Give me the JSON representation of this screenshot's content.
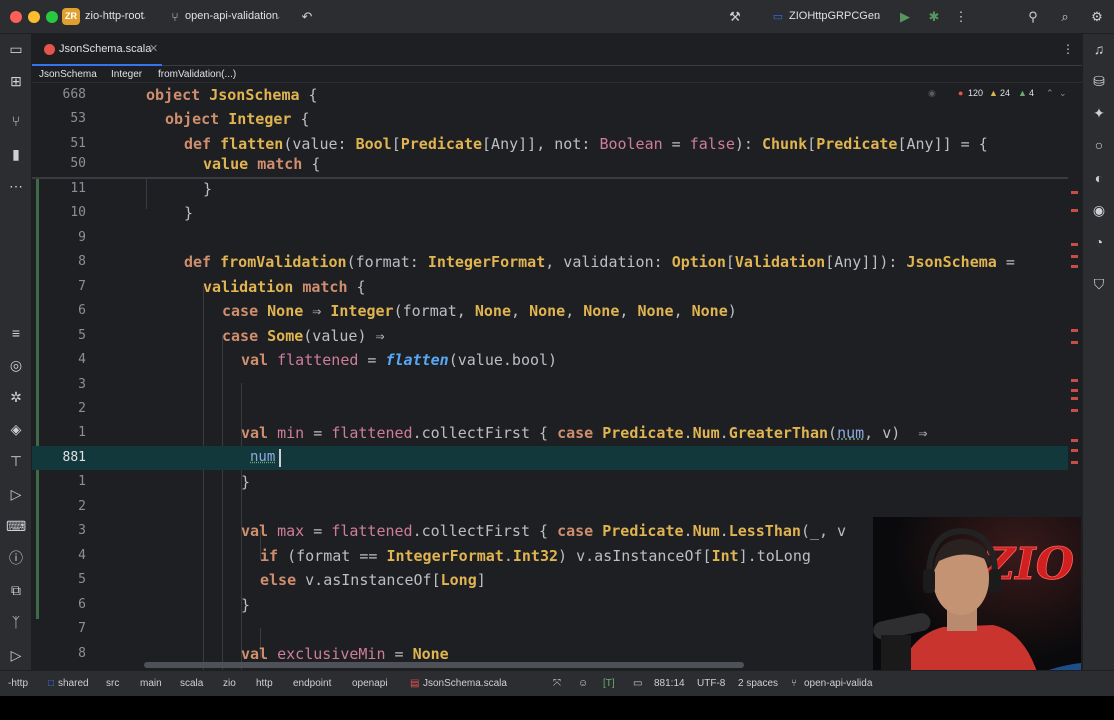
{
  "titlebar": {
    "project_badge": "ZR",
    "project_name": "zio-http-root",
    "branch": "open-api-validation",
    "run_config": "ZIOHttpGRPCGen"
  },
  "tab": {
    "label": "JsonSchema.scala"
  },
  "breadcrumb": [
    "JsonSchema",
    "Integer",
    "fromValidation(...)"
  ],
  "inspections": {
    "errors": "120",
    "warnings": "24",
    "infos": "4"
  },
  "lines": {
    "l668": "668",
    "l53": "53",
    "l51": "51",
    "l50": "50",
    "l11": "11",
    "l10": "10",
    "l9": "9",
    "l8": "8",
    "l7": "7",
    "l6": "6",
    "l5": "5",
    "l4": "4",
    "l3": "3",
    "l2": "2",
    "l1": "1",
    "l881": "881",
    "la1": "1",
    "la2": "2",
    "la3": "3",
    "la4": "4",
    "la5": "5",
    "la6": "6",
    "la7": "7",
    "la8": "8"
  },
  "code": {
    "c668": [
      "object",
      " ",
      "JsonSchema",
      " {"
    ],
    "c53": [
      "object",
      " ",
      "Integer",
      " {"
    ],
    "c51": [
      "def",
      " ",
      "flatten",
      "(value: ",
      "Bool",
      "[",
      "Predicate",
      "[Any]], not: ",
      "Boolean",
      " = ",
      "false",
      "): ",
      "Chunk",
      "[",
      "Predicate",
      "[Any]] = {"
    ],
    "c50": [
      "value",
      " ",
      "match",
      " {"
    ],
    "c11": "}",
    "c10": "}",
    "c8": [
      "def",
      " ",
      "fromValidation",
      "(format: ",
      "IntegerFormat",
      ", validation: ",
      "Option",
      "[",
      "Validation",
      "[Any]]): ",
      "JsonSchema",
      " ="
    ],
    "c7": [
      "validation",
      " ",
      "match",
      " {"
    ],
    "c6": [
      "case",
      " ",
      "None",
      " ⇒ ",
      "Integer",
      "(format, ",
      "None",
      ", ",
      "None",
      ", ",
      "None",
      ", ",
      "None",
      ", ",
      "None",
      ")"
    ],
    "c5": [
      "case",
      " ",
      "Some",
      "(value) ⇒"
    ],
    "c4": [
      "val",
      " ",
      "flattened",
      " = ",
      "flatten",
      "(value.bool)"
    ],
    "c1": [
      "val",
      " ",
      "min",
      " = ",
      "flattened",
      ".collectFirst { ",
      "case",
      " ",
      "Predicate",
      ".",
      "Num",
      ".",
      "GreaterThan",
      "(",
      "num",
      ", v)  ⇒"
    ],
    "c881": "num",
    "ca1": "}",
    "ca3": [
      "val",
      " ",
      "max",
      " = ",
      "flattened",
      ".collectFirst { ",
      "case",
      " ",
      "Predicate",
      ".",
      "Num",
      ".",
      "LessThan",
      "(_, v"
    ],
    "ca4": [
      "if",
      " (format == ",
      "IntegerFormat",
      ".",
      "Int32",
      ") v.asInstanceOf[",
      "Int",
      "].toLong"
    ],
    "ca5": [
      "else",
      " v.asInstanceOf[",
      "Long",
      "]"
    ],
    "ca6": "}",
    "ca8": [
      "val",
      " ",
      "exclusiveMin",
      " = ",
      "None"
    ]
  },
  "statusbar": {
    "path": [
      "-http",
      "shared",
      "src",
      "main",
      "scala",
      "zio",
      "http",
      "endpoint",
      "openapi",
      "JsonSchema.scala"
    ],
    "vcs_mark": "[T]",
    "position": "881:14",
    "encoding": "UTF-8",
    "indent": "2 spaces",
    "branch": "open-api-valida"
  },
  "colors": {
    "keyword": "#cf8e6d",
    "type": "#e0b450",
    "param": "#ce7e96",
    "function": "#56a8f5",
    "current_line": "#13383c",
    "accent": "#3574f0"
  },
  "icons": {
    "left": [
      "folder-icon",
      "structure-icon",
      "commit-icon",
      "bookmarks-icon",
      "more-icon",
      "list-icon",
      "services-icon",
      "debug-icon",
      "layers-icon",
      "build-icon",
      "run-icon",
      "terminal-icon",
      "problems-icon",
      "plugins-icon",
      "git-icon",
      "play-icon"
    ],
    "right": [
      "notifications-icon",
      "database-icon",
      "ai-assistant-icon",
      "sbt-icon",
      "copilot-icon",
      "endpoints-icon",
      "profiler-icon",
      "coverage-icon"
    ]
  }
}
